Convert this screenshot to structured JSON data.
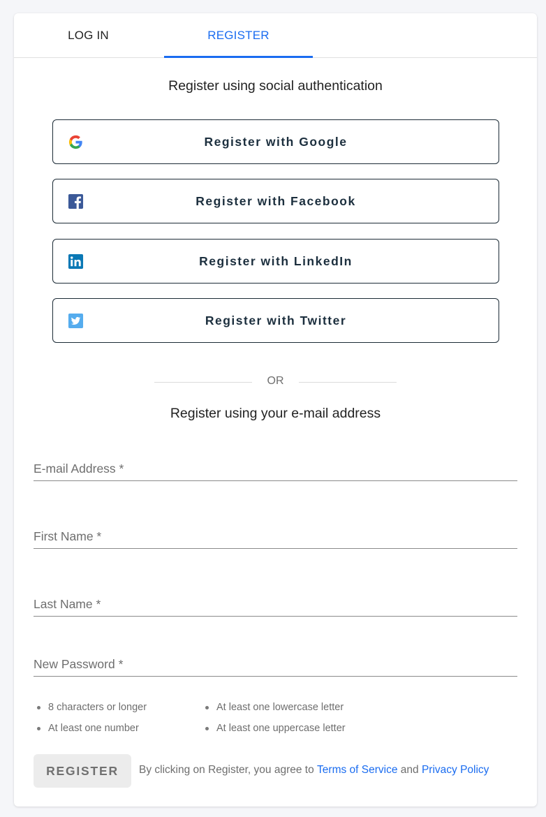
{
  "tabs": [
    {
      "label": "LOG IN",
      "active": false
    },
    {
      "label": "REGISTER",
      "active": true
    }
  ],
  "accent_color": "#1a6cf0",
  "social": {
    "heading": "Register using social authentication",
    "buttons": [
      {
        "label": "Register with Google",
        "icon": "google-icon"
      },
      {
        "label": "Register with Facebook",
        "icon": "facebook-icon"
      },
      {
        "label": "Register with LinkedIn",
        "icon": "linkedin-icon"
      },
      {
        "label": "Register with Twitter",
        "icon": "twitter-icon"
      }
    ]
  },
  "divider_text": "OR",
  "email_form": {
    "heading": "Register using your e-mail address",
    "fields": [
      {
        "label": "E-mail Address *",
        "value": ""
      },
      {
        "label": "First Name *",
        "value": ""
      },
      {
        "label": "Last Name *",
        "value": ""
      },
      {
        "label": "New Password *",
        "value": ""
      }
    ],
    "password_requirements": [
      "8 characters or longer",
      "At least one number",
      "At least one lowercase letter",
      "At least one uppercase letter"
    ],
    "submit_label": "REGISTER",
    "agreement": {
      "prefix": "By clicking on Register, you agree to",
      "terms_link": "Terms of Service",
      "conjunction": "and",
      "privacy_link": "Privacy Policy"
    }
  }
}
